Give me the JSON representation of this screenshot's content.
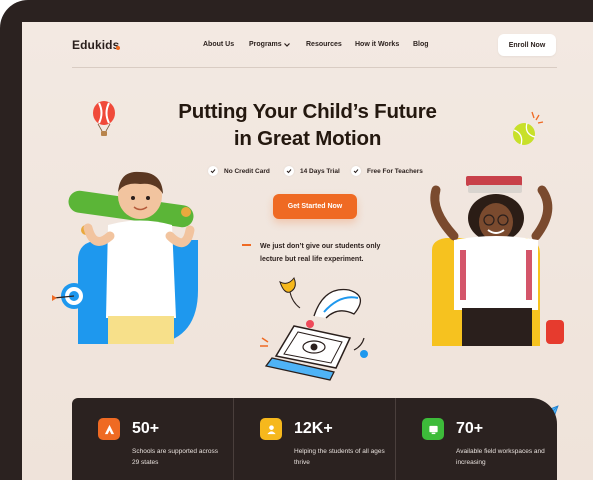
{
  "brand": {
    "name": "Edukids",
    "accent": "#ef6a23"
  },
  "nav": {
    "links": [
      "About Us",
      "Programs",
      "Resources",
      "How it Works",
      "Blog"
    ],
    "cta": "Enroll Now"
  },
  "hero": {
    "title_line1": "Putting Your Child’s Future",
    "title_line2": "in Great Motion",
    "features": [
      "No Credit Card",
      "14 Days Trial",
      "Free For Teachers"
    ],
    "cta": "Get Started Now",
    "tagline": "We just don’t give our students only lecture but real life experiment."
  },
  "stats": [
    {
      "value": "50+",
      "desc": "Schools are supported across 29 states",
      "color": "#ef6a23",
      "icon": "school-icon"
    },
    {
      "value": "12K+",
      "desc": "Helping the students of all ages thrive",
      "color": "#f6b81c",
      "icon": "student-icon"
    },
    {
      "value": "70+",
      "desc": "Available field workspaces and increasing",
      "color": "#3dbb3a",
      "icon": "workspace-icon"
    }
  ]
}
